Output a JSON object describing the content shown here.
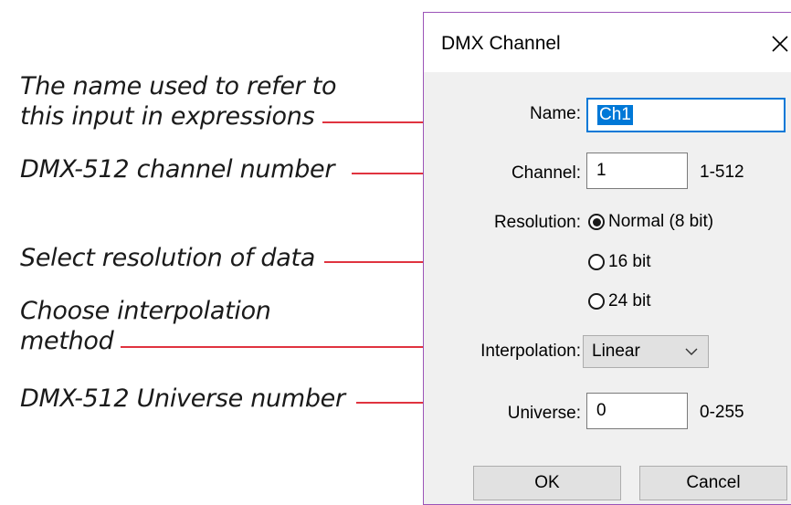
{
  "annotations": {
    "name_line1": "The name used to refer to",
    "name_line2": "this input in expressions",
    "channel": "DMX-512 channel number",
    "resolution": "Select resolution of data",
    "interp_line1": "Choose interpolation",
    "interp_line2": "method",
    "universe": "DMX-512 Universe number"
  },
  "colors": {
    "annotation_line": "#e0333f",
    "dialog_border": "#9b54b8",
    "focus": "#0078d7"
  },
  "dialog": {
    "title": "DMX Channel",
    "close_icon": "close-icon",
    "name_label": "Name:",
    "name_value": "Ch1",
    "channel_label": "Channel:",
    "channel_value": "1",
    "channel_range": "1-512",
    "resolution_label": "Resolution:",
    "resolution_options": [
      {
        "label": "Normal (8 bit)",
        "selected": true
      },
      {
        "label": "16 bit",
        "selected": false
      },
      {
        "label": "24 bit",
        "selected": false
      }
    ],
    "interpolation_label": "Interpolation:",
    "interpolation_value": "Linear",
    "universe_label": "Universe:",
    "universe_value": "0",
    "universe_range": "0-255",
    "ok_label": "OK",
    "cancel_label": "Cancel"
  }
}
